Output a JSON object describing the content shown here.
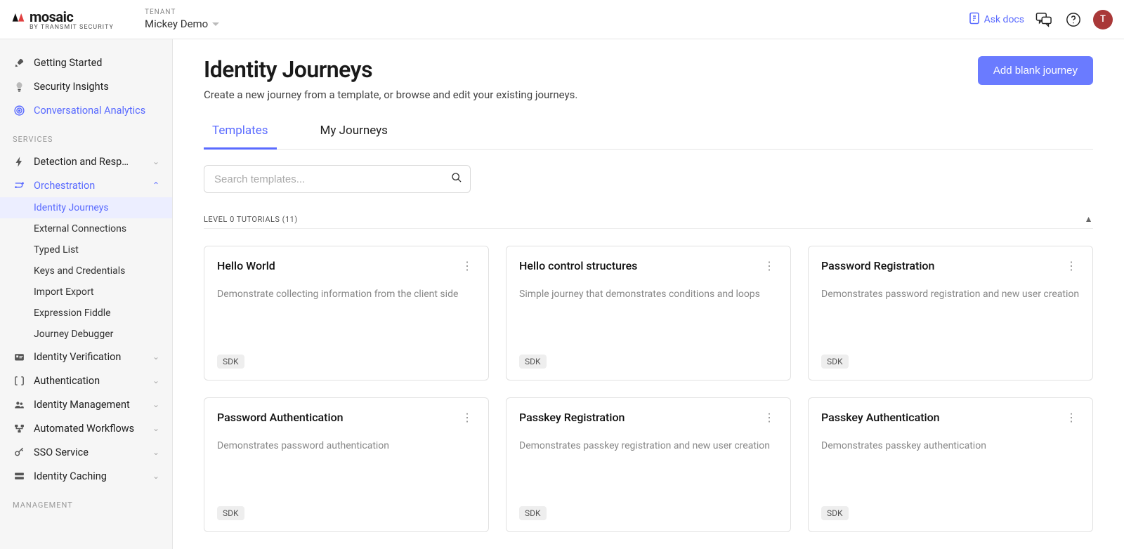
{
  "header": {
    "logo_text": "mosaic",
    "logo_sub": "BY TRANSMIT SECURITY",
    "tenant_label": "TENANT",
    "tenant_name": "Mickey Demo",
    "ask_docs": "Ask docs",
    "avatar_letter": "T"
  },
  "sidebar": {
    "top": [
      {
        "icon": "rocket",
        "label": "Getting Started"
      },
      {
        "icon": "bulb",
        "label": "Security Insights"
      },
      {
        "icon": "target",
        "label": "Conversational Analytics",
        "link": true
      }
    ],
    "services_label": "SERVICES",
    "services": [
      {
        "icon": "bolt",
        "label": "Detection and Response",
        "truncate": true,
        "expandable": true
      },
      {
        "icon": "flow",
        "label": "Orchestration",
        "expandable": true,
        "active": true,
        "children": [
          {
            "label": "Identity Journeys",
            "active": true
          },
          {
            "label": "External Connections"
          },
          {
            "label": "Typed List"
          },
          {
            "label": "Keys and Credentials"
          },
          {
            "label": "Import Export"
          },
          {
            "label": "Expression Fiddle"
          },
          {
            "label": "Journey Debugger"
          }
        ]
      },
      {
        "icon": "idcard",
        "label": "Identity Verification",
        "expandable": true
      },
      {
        "icon": "brackets",
        "label": "Authentication",
        "expandable": true
      },
      {
        "icon": "users",
        "label": "Identity Management",
        "expandable": true
      },
      {
        "icon": "workflow",
        "label": "Automated Workflows",
        "expandable": true
      },
      {
        "icon": "key",
        "label": "SSO Service",
        "expandable": true
      },
      {
        "icon": "cache",
        "label": "Identity Caching",
        "expandable": true
      }
    ],
    "management_label": "MANAGEMENT"
  },
  "page": {
    "title": "Identity Journeys",
    "subtitle": "Create a new journey from a template, or browse and edit your existing journeys.",
    "add_button": "Add blank journey",
    "tabs": [
      {
        "label": "Templates",
        "active": true
      },
      {
        "label": "My Journeys"
      }
    ],
    "search_placeholder": "Search templates...",
    "group_title": "LEVEL 0 TUTORIALS (11)",
    "templates": [
      {
        "title": "Hello World",
        "desc": "Demonstrate collecting information from the client side",
        "tag": "SDK"
      },
      {
        "title": "Hello control structures",
        "desc": "Simple journey that demonstrates conditions and loops",
        "tag": "SDK"
      },
      {
        "title": "Password Registration",
        "desc": "Demonstrates password registration and new user creation",
        "tag": "SDK"
      },
      {
        "title": "Password Authentication",
        "desc": "Demonstrates password authentication",
        "tag": "SDK"
      },
      {
        "title": "Passkey Registration",
        "desc": "Demonstrates passkey registration and new user creation",
        "tag": "SDK"
      },
      {
        "title": "Passkey Authentication",
        "desc": "Demonstrates passkey authentication",
        "tag": "SDK"
      }
    ]
  }
}
